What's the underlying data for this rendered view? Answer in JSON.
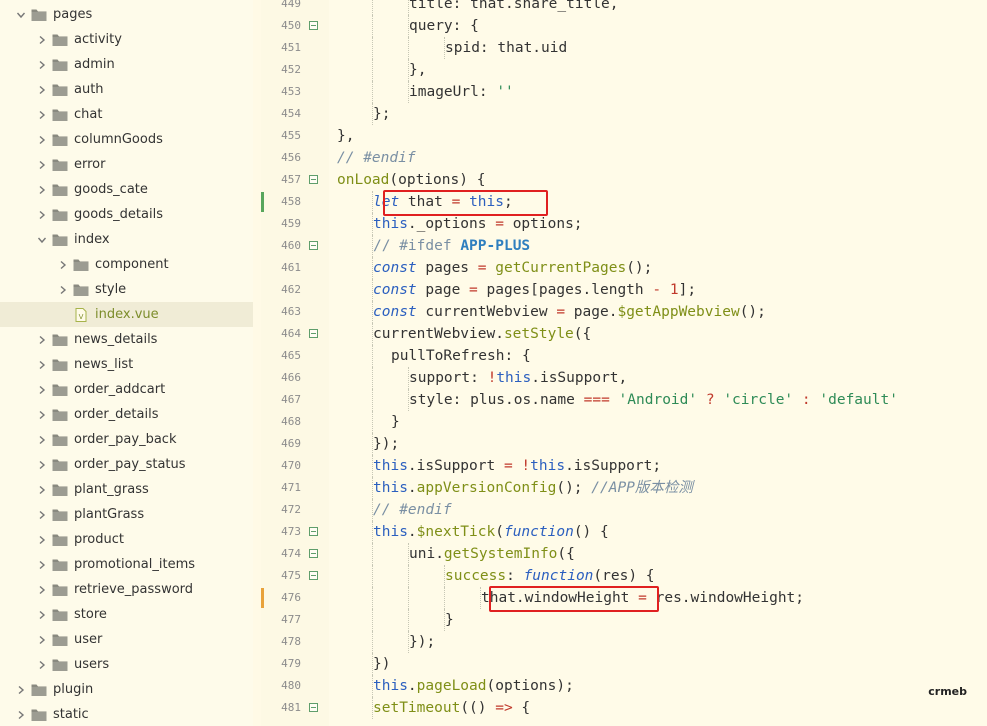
{
  "explorer": {
    "items": [
      {
        "label": "pages",
        "depth": 0,
        "expanded": true,
        "type": "folder"
      },
      {
        "label": "activity",
        "depth": 1,
        "expanded": false,
        "type": "folder"
      },
      {
        "label": "admin",
        "depth": 1,
        "expanded": false,
        "type": "folder"
      },
      {
        "label": "auth",
        "depth": 1,
        "expanded": false,
        "type": "folder"
      },
      {
        "label": "chat",
        "depth": 1,
        "expanded": false,
        "type": "folder"
      },
      {
        "label": "columnGoods",
        "depth": 1,
        "expanded": false,
        "type": "folder"
      },
      {
        "label": "error",
        "depth": 1,
        "expanded": false,
        "type": "folder"
      },
      {
        "label": "goods_cate",
        "depth": 1,
        "expanded": false,
        "type": "folder"
      },
      {
        "label": "goods_details",
        "depth": 1,
        "expanded": false,
        "type": "folder"
      },
      {
        "label": "index",
        "depth": 1,
        "expanded": true,
        "type": "folder"
      },
      {
        "label": "component",
        "depth": 2,
        "expanded": false,
        "type": "folder"
      },
      {
        "label": "style",
        "depth": 2,
        "expanded": false,
        "type": "folder"
      },
      {
        "label": "index.vue",
        "depth": 2,
        "type": "file",
        "active": true
      },
      {
        "label": "news_details",
        "depth": 1,
        "expanded": false,
        "type": "folder"
      },
      {
        "label": "news_list",
        "depth": 1,
        "expanded": false,
        "type": "folder"
      },
      {
        "label": "order_addcart",
        "depth": 1,
        "expanded": false,
        "type": "folder"
      },
      {
        "label": "order_details",
        "depth": 1,
        "expanded": false,
        "type": "folder"
      },
      {
        "label": "order_pay_back",
        "depth": 1,
        "expanded": false,
        "type": "folder"
      },
      {
        "label": "order_pay_status",
        "depth": 1,
        "expanded": false,
        "type": "folder"
      },
      {
        "label": "plant_grass",
        "depth": 1,
        "expanded": false,
        "type": "folder"
      },
      {
        "label": "plantGrass",
        "depth": 1,
        "expanded": false,
        "type": "folder"
      },
      {
        "label": "product",
        "depth": 1,
        "expanded": false,
        "type": "folder"
      },
      {
        "label": "promotional_items",
        "depth": 1,
        "expanded": false,
        "type": "folder"
      },
      {
        "label": "retrieve_password",
        "depth": 1,
        "expanded": false,
        "type": "folder"
      },
      {
        "label": "store",
        "depth": 1,
        "expanded": false,
        "type": "folder"
      },
      {
        "label": "user",
        "depth": 1,
        "expanded": false,
        "type": "folder"
      },
      {
        "label": "users",
        "depth": 1,
        "expanded": false,
        "type": "folder"
      },
      {
        "label": "plugin",
        "depth": 0,
        "expanded": false,
        "type": "folder"
      },
      {
        "label": "static",
        "depth": 0,
        "expanded": false,
        "type": "folder"
      }
    ]
  },
  "editor": {
    "lines": [
      {
        "n": "449",
        "fold": false,
        "indent": 4,
        "tokens": [
          [
            "p",
            "title: that.share_title,"
          ]
        ]
      },
      {
        "n": "450",
        "fold": true,
        "indent": 4,
        "tokens": [
          [
            "p",
            "query: {"
          ]
        ]
      },
      {
        "n": "451",
        "fold": false,
        "indent": 5,
        "tokens": [
          [
            "p",
            "spid: that.uid"
          ]
        ]
      },
      {
        "n": "452",
        "fold": false,
        "indent": 4,
        "tokens": [
          [
            "p",
            "},"
          ]
        ]
      },
      {
        "n": "453",
        "fold": false,
        "indent": 4,
        "tokens": [
          [
            "p",
            "imageUrl: "
          ],
          [
            "str",
            "''"
          ]
        ]
      },
      {
        "n": "454",
        "fold": false,
        "indent": 3,
        "tokens": [
          [
            "p",
            "};"
          ]
        ]
      },
      {
        "n": "455",
        "fold": false,
        "indent": 2,
        "tokens": [
          [
            "p",
            "},"
          ]
        ]
      },
      {
        "n": "456",
        "fold": false,
        "indent": 2,
        "tokens": [
          [
            "cm",
            "// #endif"
          ]
        ]
      },
      {
        "n": "457",
        "fold": true,
        "indent": 2,
        "tokens": [
          [
            "fn",
            "onLoad"
          ],
          [
            "p",
            "(options) {"
          ]
        ]
      },
      {
        "n": "458",
        "fold": false,
        "indent": 3,
        "mark": "green",
        "tokens": [
          [
            "kw",
            "let"
          ],
          [
            "p",
            " that "
          ],
          [
            "op",
            "="
          ],
          [
            "p",
            " "
          ],
          [
            "ths",
            "this"
          ],
          [
            "p",
            ";"
          ]
        ]
      },
      {
        "n": "459",
        "fold": false,
        "indent": 3,
        "tokens": [
          [
            "ths",
            "this"
          ],
          [
            "p",
            "._options "
          ],
          [
            "op",
            "="
          ],
          [
            "p",
            " options;"
          ]
        ]
      },
      {
        "n": "460",
        "fold": true,
        "indent": 3,
        "tokens": [
          [
            "ppcm",
            "// #ifdef "
          ],
          [
            "dir",
            "APP-PLUS"
          ]
        ]
      },
      {
        "n": "461",
        "fold": false,
        "indent": 3,
        "tokens": [
          [
            "kw",
            "const"
          ],
          [
            "p",
            " pages "
          ],
          [
            "op",
            "="
          ],
          [
            "p",
            " "
          ],
          [
            "fn",
            "getCurrentPages"
          ],
          [
            "p",
            "();"
          ]
        ]
      },
      {
        "n": "462",
        "fold": false,
        "indent": 3,
        "tokens": [
          [
            "kw",
            "const"
          ],
          [
            "p",
            " page "
          ],
          [
            "op",
            "="
          ],
          [
            "p",
            " pages[pages.length "
          ],
          [
            "op",
            "-"
          ],
          [
            "p",
            " "
          ],
          [
            "num",
            "1"
          ],
          [
            "p",
            "];"
          ]
        ]
      },
      {
        "n": "463",
        "fold": false,
        "indent": 3,
        "tokens": [
          [
            "kw",
            "const"
          ],
          [
            "p",
            " currentWebview "
          ],
          [
            "op",
            "="
          ],
          [
            "p",
            " page."
          ],
          [
            "fn",
            "$getAppWebview"
          ],
          [
            "p",
            "();"
          ]
        ]
      },
      {
        "n": "464",
        "fold": true,
        "indent": 3,
        "tokens": [
          [
            "p",
            "currentWebview."
          ],
          [
            "fn",
            "setStyle"
          ],
          [
            "p",
            "({"
          ]
        ]
      },
      {
        "n": "465",
        "fold": false,
        "indent": 3,
        "extra": "  ",
        "tokens": [
          [
            "p",
            "pullToRefresh: {"
          ]
        ]
      },
      {
        "n": "466",
        "fold": false,
        "indent": 4,
        "tokens": [
          [
            "p",
            "support: "
          ],
          [
            "op",
            "!"
          ],
          [
            "ths",
            "this"
          ],
          [
            "p",
            ".isSupport,"
          ]
        ]
      },
      {
        "n": "467",
        "fold": false,
        "indent": 4,
        "tokens": [
          [
            "p",
            "style: plus.os.name "
          ],
          [
            "op",
            "==="
          ],
          [
            "p",
            " "
          ],
          [
            "str",
            "'Android'"
          ],
          [
            "p",
            " "
          ],
          [
            "op",
            "?"
          ],
          [
            "p",
            " "
          ],
          [
            "str",
            "'circle'"
          ],
          [
            "p",
            " "
          ],
          [
            "op",
            ":"
          ],
          [
            "p",
            " "
          ],
          [
            "str",
            "'default'"
          ]
        ]
      },
      {
        "n": "468",
        "fold": false,
        "indent": 3,
        "extra": "  ",
        "tokens": [
          [
            "p",
            "}"
          ]
        ]
      },
      {
        "n": "469",
        "fold": false,
        "indent": 3,
        "tokens": [
          [
            "p",
            "});"
          ]
        ]
      },
      {
        "n": "470",
        "fold": false,
        "indent": 3,
        "tokens": [
          [
            "ths",
            "this"
          ],
          [
            "p",
            ".isSupport "
          ],
          [
            "op",
            "="
          ],
          [
            "p",
            " "
          ],
          [
            "op",
            "!"
          ],
          [
            "ths",
            "this"
          ],
          [
            "p",
            ".isSupport;"
          ]
        ]
      },
      {
        "n": "471",
        "fold": false,
        "indent": 3,
        "tokens": [
          [
            "ths",
            "this"
          ],
          [
            "p",
            "."
          ],
          [
            "fn",
            "appVersionConfig"
          ],
          [
            "p",
            "(); "
          ],
          [
            "cm",
            "//APP版本检测"
          ]
        ]
      },
      {
        "n": "472",
        "fold": false,
        "indent": 3,
        "tokens": [
          [
            "cm",
            "// #endif"
          ]
        ]
      },
      {
        "n": "473",
        "fold": true,
        "indent": 3,
        "tokens": [
          [
            "ths",
            "this"
          ],
          [
            "p",
            "."
          ],
          [
            "fn",
            "$nextTick"
          ],
          [
            "p",
            "("
          ],
          [
            "kw",
            "function"
          ],
          [
            "p",
            "() {"
          ]
        ]
      },
      {
        "n": "474",
        "fold": true,
        "indent": 4,
        "tokens": [
          [
            "p",
            "uni."
          ],
          [
            "fn",
            "getSystemInfo"
          ],
          [
            "p",
            "({"
          ]
        ]
      },
      {
        "n": "475",
        "fold": true,
        "indent": 5,
        "tokens": [
          [
            "fn",
            "success"
          ],
          [
            "p",
            ": "
          ],
          [
            "kw",
            "function"
          ],
          [
            "p",
            "(res) {"
          ]
        ]
      },
      {
        "n": "476",
        "fold": false,
        "indent": 6,
        "mark": "orange",
        "tokens": [
          [
            "p",
            "that.windowHeight "
          ],
          [
            "op",
            "="
          ],
          [
            "p",
            " res.windowHeight;"
          ]
        ]
      },
      {
        "n": "477",
        "fold": false,
        "indent": 5,
        "tokens": [
          [
            "p",
            "}"
          ]
        ]
      },
      {
        "n": "478",
        "fold": false,
        "indent": 4,
        "tokens": [
          [
            "p",
            "});"
          ]
        ]
      },
      {
        "n": "479",
        "fold": false,
        "indent": 3,
        "tokens": [
          [
            "p",
            "})"
          ]
        ]
      },
      {
        "n": "480",
        "fold": false,
        "indent": 3,
        "tokens": [
          [
            "ths",
            "this"
          ],
          [
            "p",
            "."
          ],
          [
            "fn",
            "pageLoad"
          ],
          [
            "p",
            "(options);"
          ]
        ]
      },
      {
        "n": "481",
        "fold": true,
        "indent": 3,
        "tokens": [
          [
            "fn",
            "setTimeout"
          ],
          [
            "p",
            "(() "
          ],
          [
            "op",
            "=>"
          ],
          [
            "p",
            " {"
          ]
        ]
      }
    ],
    "highlights": [
      {
        "name": "highlight-let-that",
        "label": "let that = this;"
      },
      {
        "name": "highlight-window-height",
        "label": "that.windowHeight"
      }
    ]
  },
  "watermark": "crmeb",
  "colors": {
    "accent_green": "#5f9e6b",
    "mark_green": "#58a65c",
    "mark_orange": "#e8a23a",
    "highlight": "#e02020"
  }
}
